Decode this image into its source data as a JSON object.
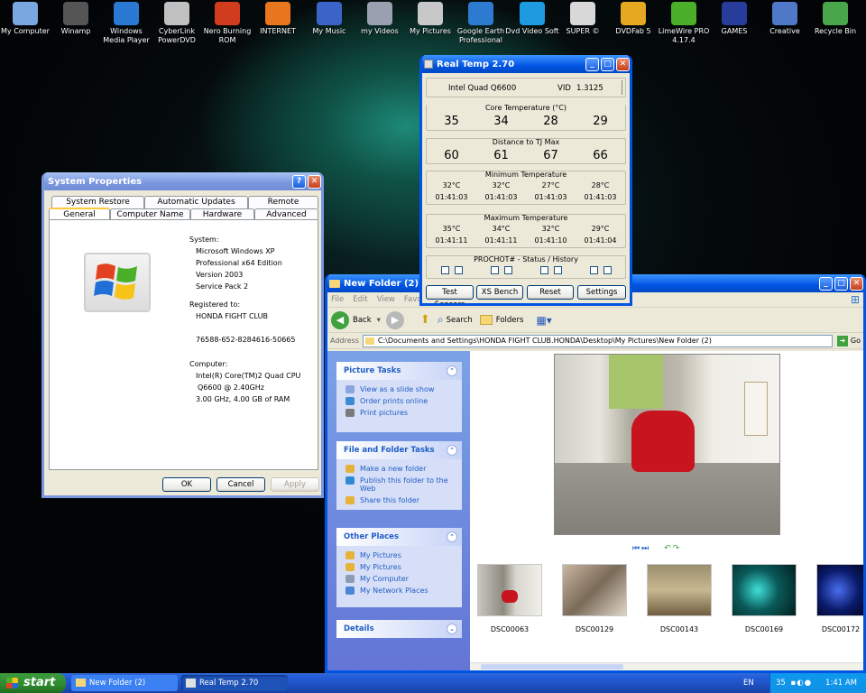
{
  "desktop_icons": [
    {
      "label": "My Computer",
      "icon": "computer-icon",
      "color": "#7aa7e0"
    },
    {
      "label": "Winamp",
      "icon": "winamp-icon",
      "color": "#555555"
    },
    {
      "label": "Windows Media Player",
      "icon": "media-player-icon",
      "color": "#2a7ad4"
    },
    {
      "label": "CyberLink PowerDVD",
      "icon": "dvd-disc-icon",
      "color": "#c0c0c0"
    },
    {
      "label": "Nero Burning ROM",
      "icon": "nero-icon",
      "color": "#d23c1e"
    },
    {
      "label": "INTERNET",
      "icon": "firefox-icon",
      "color": "#e8761e"
    },
    {
      "label": "My Music",
      "icon": "music-folder-icon",
      "color": "#3c64c8"
    },
    {
      "label": "my Videos",
      "icon": "video-folder-icon",
      "color": "#9aa0b0"
    },
    {
      "label": "My Pictures",
      "icon": "pictures-folder-icon",
      "color": "#c8c8c8"
    },
    {
      "label": "Google Earth Professional",
      "icon": "globe-icon",
      "color": "#2d7bd1"
    },
    {
      "label": "Dvd Video Soft",
      "icon": "dvd-video-icon",
      "color": "#1e9ae0"
    },
    {
      "label": "SUPER ©",
      "icon": "super-icon",
      "color": "#d8d8d8"
    },
    {
      "label": "DVDFab 5",
      "icon": "dvdfab-icon",
      "color": "#e6a820"
    },
    {
      "label": "LimeWire PRO 4.17.4",
      "icon": "limewire-icon",
      "color": "#4caf2a"
    },
    {
      "label": "GAMES",
      "icon": "games-icon",
      "color": "#283c9c"
    },
    {
      "label": "Creative",
      "icon": "creative-icon",
      "color": "#5078c8"
    },
    {
      "label": "Recycle Bin",
      "icon": "recycle-bin-icon",
      "color": "#4aa64a"
    }
  ],
  "system_properties": {
    "title": "System Properties",
    "tabs_row1": [
      "System Restore",
      "Automatic Updates",
      "Remote"
    ],
    "tabs_row2": [
      "General",
      "Computer Name",
      "Hardware",
      "Advanced"
    ],
    "lines": {
      "system_label": "System:",
      "os": "Microsoft Windows XP",
      "edition": "Professional x64 Edition",
      "version": "Version 2003",
      "sp": "Service Pack 2",
      "registered_label": "Registered to:",
      "owner": "HONDA FIGHT CLUB",
      "product_id": "76588-652-8284616-50665",
      "computer_label": "Computer:",
      "cpu1": "Intel(R) Core(TM)2 Quad CPU",
      "cpu2": "Q6600  @ 2.40GHz",
      "ram": "3.00 GHz, 4.00 GB of RAM"
    },
    "buttons": {
      "ok": "OK",
      "cancel": "Cancel",
      "apply": "Apply"
    }
  },
  "realtemp": {
    "title": "Real Temp 2.70",
    "cpu": "Intel Quad Q6600",
    "vid_label": "VID",
    "vid": "1.3125",
    "core_label": "Core Temperature (°C)",
    "core": [
      "35",
      "34",
      "28",
      "29"
    ],
    "tj_label": "Distance to TJ Max",
    "tj": [
      "60",
      "61",
      "67",
      "66"
    ],
    "min_label": "Minimum Temperature",
    "min_temp": [
      "32°C",
      "32°C",
      "27°C",
      "28°C"
    ],
    "min_time": [
      "01:41:03",
      "01:41:03",
      "01:41:03",
      "01:41:03"
    ],
    "max_label": "Maximum Temperature",
    "max_temp": [
      "35°C",
      "34°C",
      "32°C",
      "29°C"
    ],
    "max_time": [
      "01:41:11",
      "01:41:11",
      "01:41:10",
      "01:41:04"
    ],
    "prochot_label": "PROCHOT#   -   Status / History",
    "buttons": [
      "Test Sensors",
      "XS Bench",
      "Reset",
      "Settings"
    ]
  },
  "explorer": {
    "title": "New Folder (2)",
    "menu": [
      "File",
      "Edit",
      "View",
      "Favo"
    ],
    "toolbar": {
      "back": "Back",
      "search": "Search",
      "folders": "Folders"
    },
    "address_label": "Address",
    "address": "C:\\Documents and Settings\\HONDA FIGHT CLUB.HONDA\\Desktop\\My Pictures\\New Folder (2)",
    "go": "Go",
    "picture_tasks": {
      "title": "Picture Tasks",
      "items": [
        "View as a slide show",
        "Order prints online",
        "Print pictures"
      ]
    },
    "file_tasks": {
      "title": "File and Folder Tasks",
      "items": [
        "Make a new folder",
        "Publish this folder to the Web",
        "Share this folder"
      ]
    },
    "other_places": {
      "title": "Other Places",
      "items": [
        "My Pictures",
        "My Pictures",
        "My Computer",
        "My Network Places"
      ]
    },
    "details": {
      "title": "Details"
    },
    "thumbnails": [
      "DSC00063",
      "DSC00129",
      "DSC00143",
      "DSC00169",
      "DSC00172"
    ]
  },
  "taskbar": {
    "start": "start",
    "tasks": [
      "New Folder (2)",
      "Real Temp 2.70"
    ],
    "lang": "EN",
    "tray_temp": "35",
    "clock": "1:41 AM"
  }
}
